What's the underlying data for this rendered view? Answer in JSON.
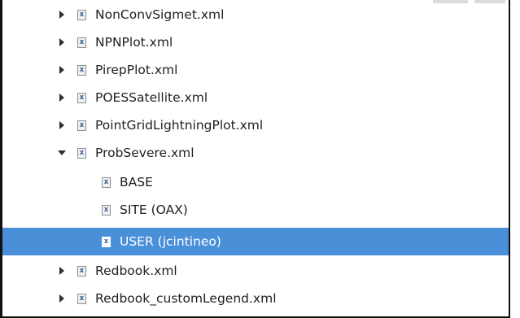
{
  "tree": {
    "items": [
      {
        "label": "NonConvSigmet.xml",
        "state": "collapsed",
        "icon": "xml-file-icon"
      },
      {
        "label": "NPNPlot.xml",
        "state": "collapsed",
        "icon": "xml-file-icon"
      },
      {
        "label": "PirepPlot.xml",
        "state": "collapsed",
        "icon": "xml-file-icon"
      },
      {
        "label": "POESSatellite.xml",
        "state": "collapsed",
        "icon": "xml-file-icon"
      },
      {
        "label": "PointGridLightningPlot.xml",
        "state": "collapsed",
        "icon": "xml-file-icon"
      },
      {
        "label": "ProbSevere.xml",
        "state": "expanded",
        "icon": "xml-file-icon"
      },
      {
        "label": "BASE",
        "state": "leaf",
        "icon": "xml-file-icon"
      },
      {
        "label": "SITE (OAX)",
        "state": "leaf",
        "icon": "xml-file-icon"
      },
      {
        "label": "USER (jcintineo)",
        "state": "leaf",
        "selected": true,
        "icon": "xml-file-icon"
      },
      {
        "label": "Redbook.xml",
        "state": "collapsed",
        "icon": "xml-file-icon"
      },
      {
        "label": "Redbook_customLegend.xml",
        "state": "collapsed",
        "icon": "xml-file-icon"
      }
    ],
    "icon_glyph": "x",
    "selection_color": "#4a90d9"
  }
}
